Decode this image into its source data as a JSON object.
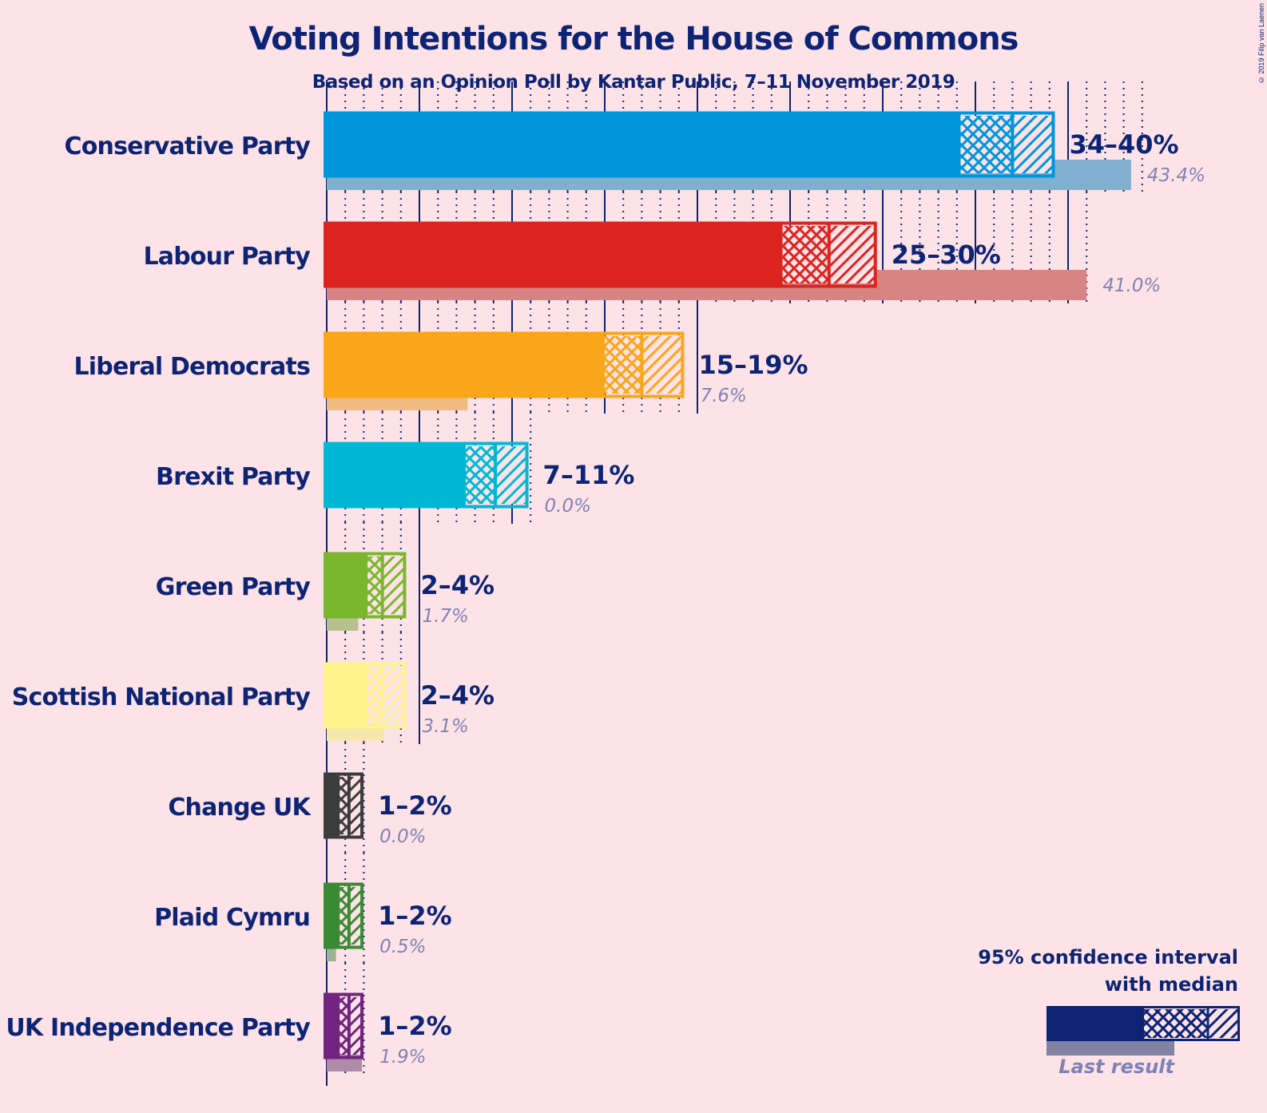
{
  "title": "Voting Intentions for the House of Commons",
  "subtitle": "Based on an Opinion Poll by Kantar Public, 7–11 November 2019",
  "copyright": "© 2019 Filip van Laenen",
  "legend": {
    "line1": "95% confidence interval",
    "line2": "with median",
    "last_result": "Last result",
    "color": "#0d2475",
    "last_color": "#8083a3"
  },
  "chart_data": {
    "type": "bar",
    "orientation": "horizontal",
    "title": "Voting Intentions for the House of Commons",
    "subtitle": "Based on an Opinion Poll by Kantar Public, 7–11 November 2019",
    "xlabel": "",
    "ylabel": "",
    "unit": "%",
    "xlim": [
      0,
      45
    ],
    "grid": "major every 5%, minor dotted every 1%",
    "legend_position": "bottom-right",
    "series": [
      {
        "party": "Conservative Party",
        "range_label": "34–40%",
        "ci_low": 34.2,
        "median": 37.0,
        "ci_high": 39.2,
        "last_result": 43.4,
        "last_label": "43.4%",
        "color": "#0096db",
        "last_color": "#80afd0"
      },
      {
        "party": "Labour Party",
        "range_label": "25–30%",
        "ci_low": 24.6,
        "median": 27.1,
        "ci_high": 29.6,
        "last_result": 41.0,
        "last_label": "41.0%",
        "color": "#dc241f",
        "last_color": "#d88484"
      },
      {
        "party": "Liberal Democrats",
        "range_label": "15–19%",
        "ci_low": 15.0,
        "median": 17.0,
        "ci_high": 19.2,
        "last_result": 7.6,
        "last_label": "7.6%",
        "color": "#faa61a",
        "last_color": "#f0bb80"
      },
      {
        "party": "Brexit Party",
        "range_label": "7–11%",
        "ci_low": 7.5,
        "median": 9.1,
        "ci_high": 10.8,
        "last_result": 0.0,
        "last_label": "0.0%",
        "color": "#00b8d4",
        "last_color": "#80c8d8"
      },
      {
        "party": "Green Party",
        "range_label": "2–4%",
        "ci_low": 2.2,
        "median": 3.0,
        "ci_high": 4.2,
        "last_result": 1.7,
        "last_label": "1.7%",
        "color": "#7ab72c",
        "last_color": "#b7c08e"
      },
      {
        "party": "Scottish National Party",
        "range_label": "2–4%",
        "ci_low": 2.2,
        "median": 3.0,
        "ci_high": 4.2,
        "last_result": 3.1,
        "last_label": "3.1%",
        "color": "#fff58c",
        "last_color": "#f8e7ad"
      },
      {
        "party": "Change UK",
        "range_label": "1–2%",
        "ci_low": 0.7,
        "median": 1.2,
        "ci_high": 1.9,
        "last_result": 0.0,
        "last_label": "0.0%",
        "color": "#3c3c3c",
        "last_color": "#9a9090"
      },
      {
        "party": "Plaid Cymru",
        "range_label": "1–2%",
        "ci_low": 0.7,
        "median": 1.2,
        "ci_high": 1.9,
        "last_result": 0.5,
        "last_label": "0.5%",
        "color": "#3a8a35",
        "last_color": "#9cb394"
      },
      {
        "party": "UK Independence Party",
        "range_label": "1–2%",
        "ci_low": 0.7,
        "median": 1.2,
        "ci_high": 1.9,
        "last_result": 1.9,
        "last_label": "1.9%",
        "color": "#70237f",
        "last_color": "#b08ba8"
      }
    ]
  }
}
